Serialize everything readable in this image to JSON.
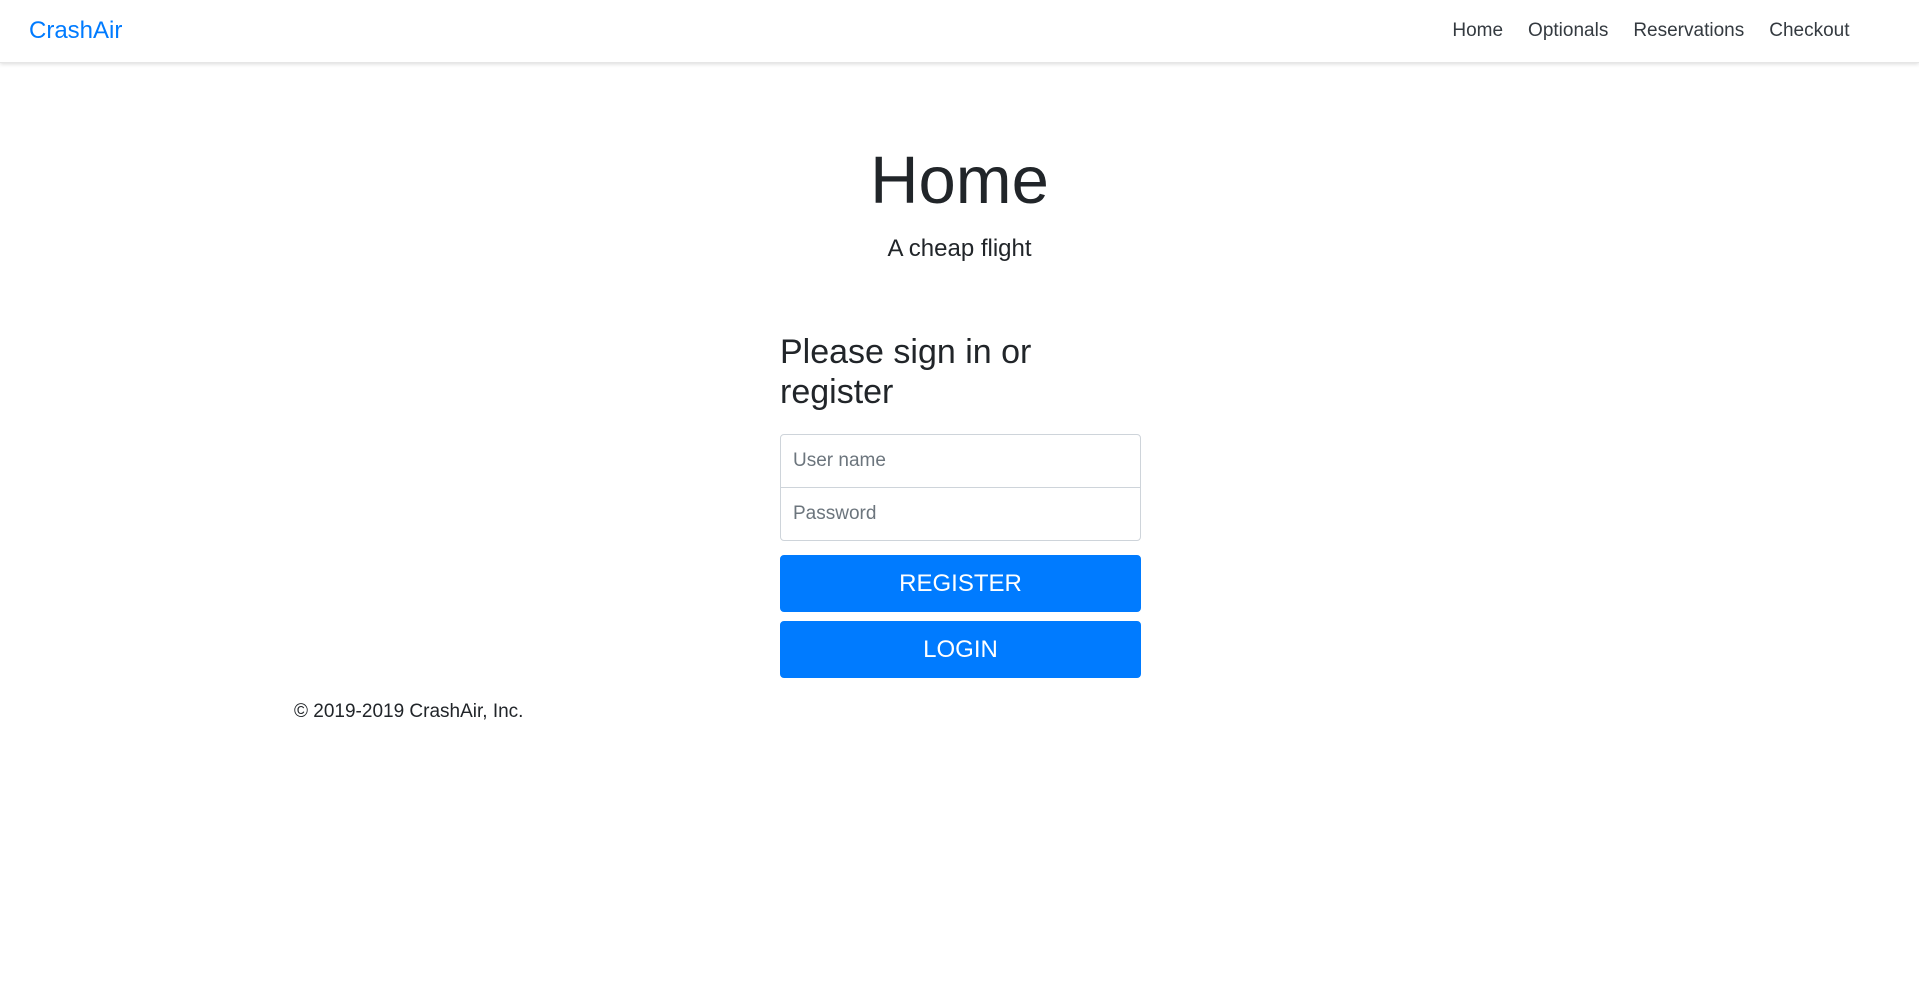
{
  "navbar": {
    "brand": "CrashAir",
    "links": [
      "Home",
      "Optionals",
      "Reservations",
      "Checkout"
    ]
  },
  "hero": {
    "title": "Home",
    "subtitle": "A cheap flight"
  },
  "signin": {
    "title": "Please sign in or register",
    "username": {
      "value": "",
      "placeholder": "User name"
    },
    "password": {
      "value": "",
      "placeholder": "Password"
    },
    "register_label": "REGISTER",
    "login_label": "LOGIN"
  },
  "footer": {
    "copyright": "© 2019-2019 CrashAir, Inc."
  },
  "colors": {
    "accent": "#007bff",
    "text": "#212529",
    "nav_text": "#343a40"
  }
}
